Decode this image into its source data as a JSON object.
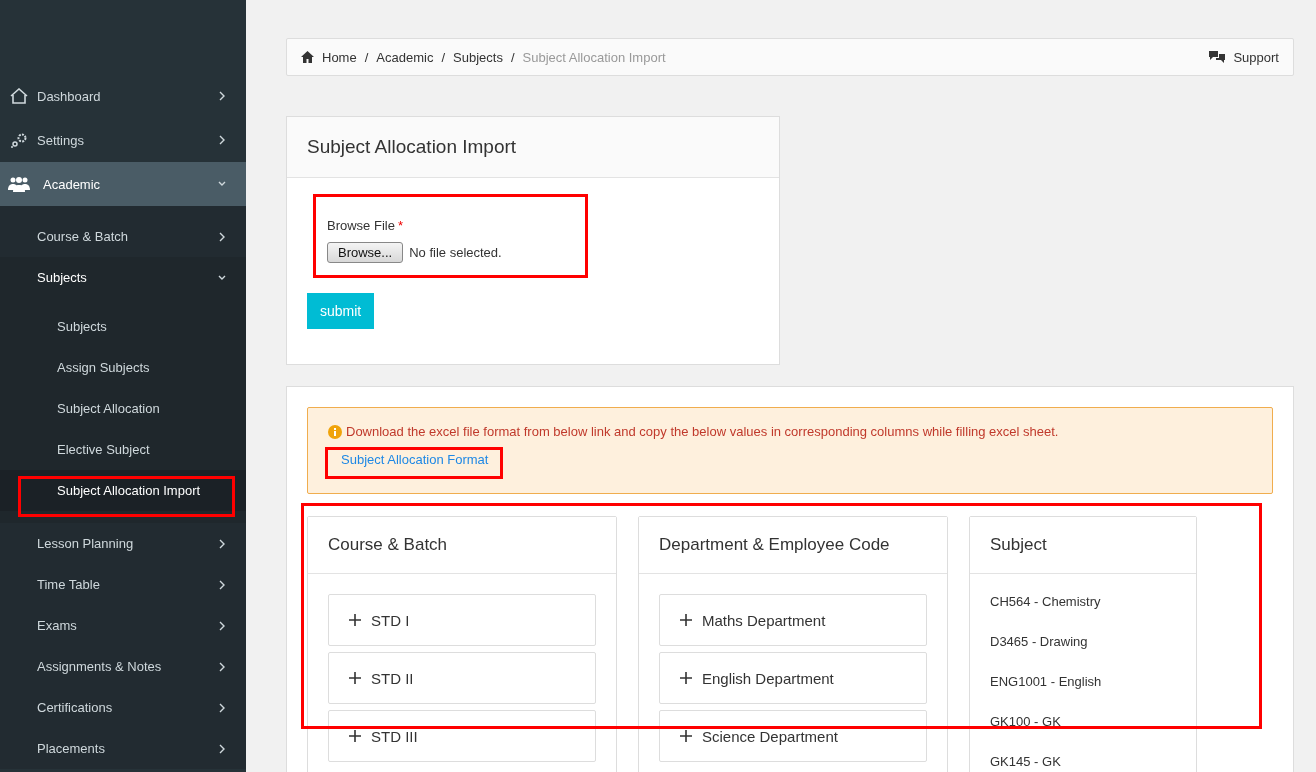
{
  "sidebar": {
    "items": [
      {
        "label": "Dashboard",
        "selected": false,
        "expanded": false
      },
      {
        "label": "Settings",
        "selected": false,
        "expanded": false
      },
      {
        "label": "Academic",
        "selected": true,
        "expanded": true,
        "children": [
          {
            "label": "Course & Batch",
            "selected": false,
            "expanded": false
          },
          {
            "label": "Subjects",
            "selected": true,
            "expanded": true,
            "children": [
              {
                "label": "Subjects",
                "selected": false
              },
              {
                "label": "Assign Subjects",
                "selected": false
              },
              {
                "label": "Subject Allocation",
                "selected": false
              },
              {
                "label": "Elective Subject",
                "selected": false
              },
              {
                "label": "Subject Allocation Import",
                "selected": true
              }
            ]
          },
          {
            "label": "Lesson Planning",
            "selected": false,
            "expanded": false
          },
          {
            "label": "Time Table",
            "selected": false,
            "expanded": false
          },
          {
            "label": "Exams",
            "selected": false,
            "expanded": false
          },
          {
            "label": "Assignments & Notes",
            "selected": false,
            "expanded": false
          },
          {
            "label": "Certifications",
            "selected": false,
            "expanded": false
          },
          {
            "label": "Placements",
            "selected": false,
            "expanded": false
          }
        ]
      }
    ]
  },
  "breadcrumb": {
    "items": [
      "Home",
      "Academic",
      "Subjects",
      "Subject Allocation Import"
    ],
    "separator": "/",
    "support": "Support"
  },
  "import_card": {
    "title": "Subject Allocation Import",
    "field_label": "Browse File",
    "required_mark": "*",
    "browse_button": "Browse...",
    "file_status": "No file selected.",
    "submit": "submit"
  },
  "info": {
    "message": "Download the excel file format from below link and copy the below values in corresponding columns while filling excel sheet.",
    "link": "Subject Allocation Format"
  },
  "columns": [
    {
      "title": "Course & Batch",
      "kind": "accordion",
      "items": [
        "STD I",
        "STD II",
        "STD III"
      ]
    },
    {
      "title": "Department & Employee Code",
      "kind": "accordion",
      "items": [
        "Maths Department",
        "English Department",
        "Science Department"
      ]
    },
    {
      "title": "Subject",
      "kind": "list",
      "items": [
        "CH564 - Chemistry",
        "D3465 - Drawing",
        "ENG1001 - English",
        "GK100 - GK",
        "GK145 - GK"
      ]
    }
  ]
}
